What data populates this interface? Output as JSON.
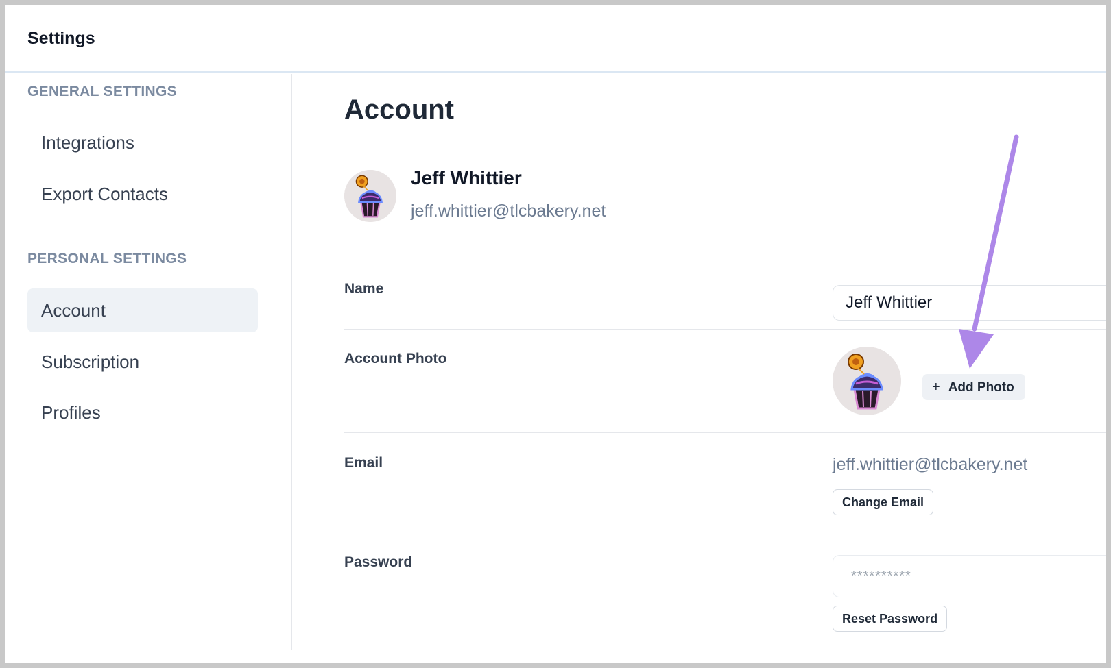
{
  "app": {
    "title": "Settings"
  },
  "sidebar": {
    "general_label": "GENERAL SETTINGS",
    "general_items": [
      {
        "label": "Integrations"
      },
      {
        "label": "Export Contacts"
      }
    ],
    "personal_label": "PERSONAL SETTINGS",
    "personal_items": [
      {
        "label": "Account",
        "active": true
      },
      {
        "label": "Subscription"
      },
      {
        "label": "Profiles"
      }
    ]
  },
  "main": {
    "title": "Account",
    "profile": {
      "name": "Jeff Whittier",
      "email": "jeff.whittier@tlcbakery.net",
      "avatar_icon": "cupcake-icon"
    },
    "fields": {
      "name": {
        "label": "Name",
        "value": "Jeff Whittier"
      },
      "photo": {
        "label": "Account Photo",
        "add_button": "Add Photo",
        "add_icon": "plus-icon"
      },
      "email": {
        "label": "Email",
        "value": "jeff.whittier@tlcbakery.net",
        "change_button": "Change Email"
      },
      "password": {
        "label": "Password",
        "masked_value": "**********",
        "reset_button": "Reset Password"
      }
    }
  },
  "colors": {
    "accent_arrow": "#ad87e8",
    "sidebar_section": "#7b8aa0",
    "active_nav_bg": "#eef2f6"
  }
}
